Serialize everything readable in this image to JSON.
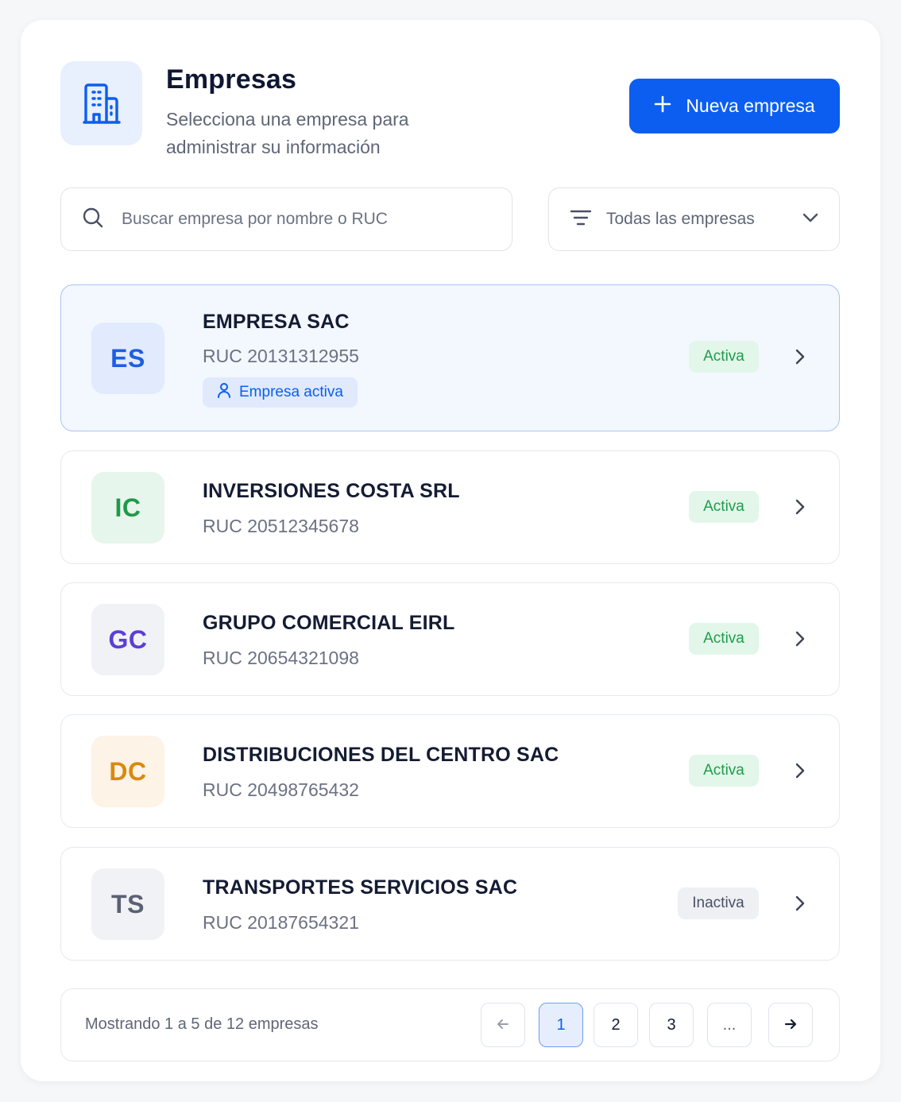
{
  "header": {
    "title": "Empresas",
    "subtitle": "Selecciona una empresa para administrar su información",
    "new_button_label": "Nueva empresa",
    "icon": "building-icon"
  },
  "search": {
    "placeholder": "Buscar empresa por nombre o RUC",
    "value": ""
  },
  "filter": {
    "selected": "Todas las empresas"
  },
  "companies": [
    {
      "initials": "ES",
      "name": "EMPRESA SAC",
      "ruc": "RUC 20131312955",
      "status": "Activa",
      "current_label": "Empresa activa",
      "color": "#1d5fe0",
      "bg": "#e2ebfd"
    },
    {
      "initials": "IC",
      "name": "INVERSIONES COSTA SRL",
      "ruc": "RUC 20512345678",
      "status": "Activa",
      "color": "#1f9a48",
      "bg": "#e7f6ec"
    },
    {
      "initials": "GC",
      "name": "GRUPO COMERCIAL EIRL",
      "ruc": "RUC 20654321098",
      "status": "Activa",
      "color": "#5b3fd6",
      "bg": "#f1f2f6"
    },
    {
      "initials": "DC",
      "name": "DISTRIBUCIONES DEL CENTRO SAC",
      "ruc": "RUC 20498765432",
      "status": "Activa",
      "color": "#d98a0b",
      "bg": "#fdf3e6"
    },
    {
      "initials": "TS",
      "name": "TRANSPORTES SERVICIOS SAC",
      "ruc": "RUC 20187654321",
      "status": "Inactiva",
      "color": "#5a6172",
      "bg": "#f1f2f5"
    }
  ],
  "pagination": {
    "info": "Mostrando 1 a 5 de 12 empresas",
    "pages": [
      "1",
      "2",
      "3",
      "..."
    ],
    "current": "1"
  },
  "colors": {
    "primary": "#0b5ef0",
    "active_badge_bg": "#e3f6ea",
    "active_badge_text": "#1e9d4b",
    "inactive_badge_bg": "#eef0f3"
  }
}
